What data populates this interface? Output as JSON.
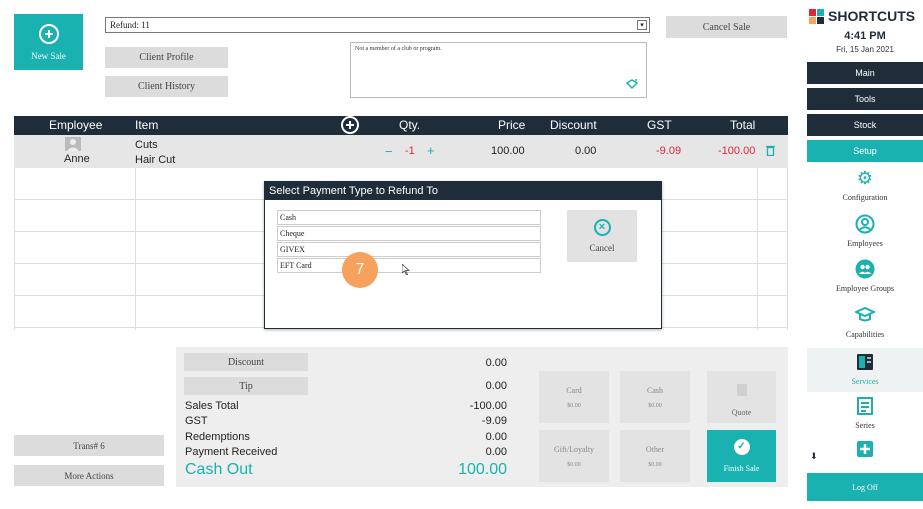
{
  "new_sale": {
    "label": "New Sale"
  },
  "refund_select": {
    "value": "Refund: 11"
  },
  "cancel_sale": "Cancel Sale",
  "client_profile": "Client Profile",
  "client_history": "Client History",
  "club_note": "Not a member of a club or program.",
  "table": {
    "headers": {
      "employee": "Employee",
      "item": "Item",
      "qty": "Qty.",
      "price": "Price",
      "discount": "Discount",
      "gst": "GST",
      "total": "Total"
    },
    "row": {
      "employee": "Anne",
      "item_category": "Cuts",
      "item_name": "Hair Cut",
      "qty_minus": "−",
      "qty": "-1",
      "qty_plus": "+",
      "price": "100.00",
      "discount": "0.00",
      "gst": "-9.09",
      "total": "-100.00"
    }
  },
  "modal": {
    "title": "Select Payment Type to Refund To",
    "options": [
      "Cash",
      "Cheque",
      "GIVEX",
      "EFT Card"
    ],
    "cancel": "Cancel"
  },
  "step_badge": "7",
  "totals": {
    "discount_btn": "Discount",
    "tip_btn": "Tip",
    "discount_val": "0.00",
    "tip_val": "0.00",
    "sales_total_lbl": "Sales Total",
    "sales_total_val": "-100.00",
    "gst_lbl": "GST",
    "gst_val": "-9.09",
    "redemptions_lbl": "Redemptions",
    "redemptions_val": "0.00",
    "payment_received_lbl": "Payment Received",
    "payment_received_val": "0.00",
    "cash_out_lbl": "Cash Out",
    "cash_out_val": "100.00"
  },
  "payments": {
    "card": {
      "label": "Card",
      "amount": "$0.00"
    },
    "cash": {
      "label": "Cash",
      "amount": "$0.00"
    },
    "gift": {
      "label": "Gift/Loyalty",
      "amount": "$0.00"
    },
    "other": {
      "label": "Other",
      "amount": "$0.00"
    },
    "quote": "Quote",
    "finish": "Finish Sale"
  },
  "trans": "Trans# 6",
  "more_actions": "More Actions",
  "sidebar": {
    "logo": "SHORTCUTS",
    "time": "4:41 PM",
    "date": "Fri, 15 Jan 2021",
    "nav": [
      "Main",
      "Tools",
      "Stock",
      "Setup"
    ],
    "items": [
      "Configuration",
      "Employees",
      "Employee Groups",
      "Capabilities",
      "Services",
      "Series"
    ],
    "logoff": "Log Off"
  },
  "colors": {
    "accent": "#19b2b0",
    "dark": "#1f2c3a",
    "negative": "#e0263a",
    "badge": "#f6a25d"
  }
}
